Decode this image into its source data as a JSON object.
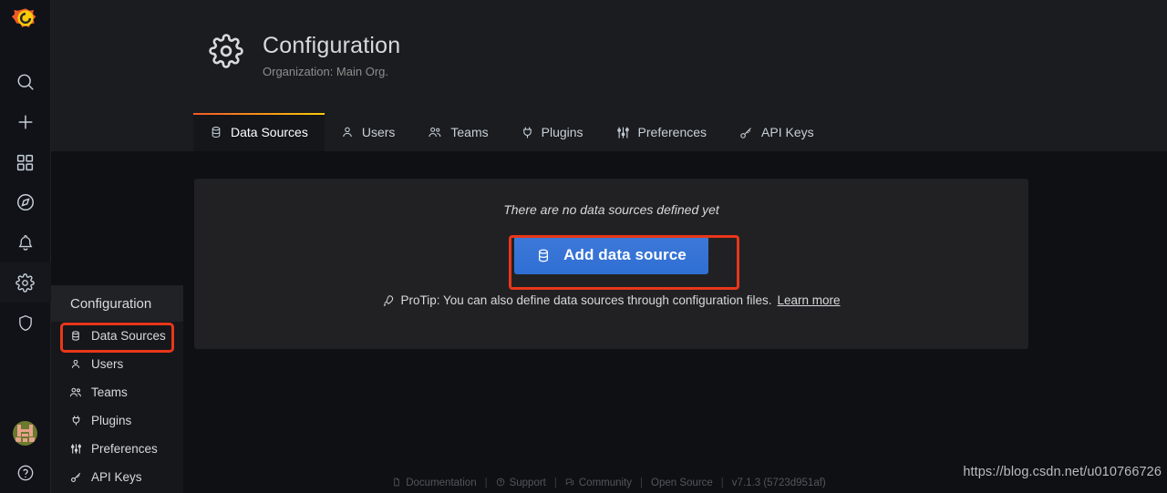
{
  "app": {
    "logo_icon": "grafana-logo-icon",
    "background_color": "#0e1014",
    "panel_color": "#212124",
    "accent_color": "#3274d9",
    "highlight_color": "#e8371a",
    "tab_gradient_from": "#f05a28",
    "tab_gradient_to": "#fbca0a"
  },
  "sidebar": {
    "items": [
      {
        "name": "search",
        "icon": "search-icon",
        "label": "Search"
      },
      {
        "name": "create",
        "icon": "plus-icon",
        "label": "Create"
      },
      {
        "name": "dashboards",
        "icon": "apps-grid-icon",
        "label": "Dashboards"
      },
      {
        "name": "explore",
        "icon": "compass-icon",
        "label": "Explore"
      },
      {
        "name": "alerting",
        "icon": "bell-icon",
        "label": "Alerting"
      },
      {
        "name": "configuration",
        "icon": "gear-icon",
        "label": "Configuration",
        "active": true
      },
      {
        "name": "server-admin",
        "icon": "shield-icon",
        "label": "Server Admin"
      }
    ],
    "bottom": [
      {
        "name": "user-avatar",
        "icon": "avatar-icon",
        "label": "User"
      },
      {
        "name": "help",
        "icon": "question-circle-icon",
        "label": "Help"
      }
    ]
  },
  "header": {
    "icon": "gear-icon",
    "title": "Configuration",
    "subtitle": "Organization: Main Org."
  },
  "tabs": [
    {
      "label": "Data Sources",
      "icon": "database-icon",
      "active": true
    },
    {
      "label": "Users",
      "icon": "user-icon",
      "active": false
    },
    {
      "label": "Teams",
      "icon": "users-alt-icon",
      "active": false
    },
    {
      "label": "Plugins",
      "icon": "plug-icon",
      "active": false
    },
    {
      "label": "Preferences",
      "icon": "sliders-icon",
      "active": false
    },
    {
      "label": "API Keys",
      "icon": "key-icon",
      "active": false
    }
  ],
  "panel": {
    "empty_message": "There are no data sources defined yet",
    "add_button": {
      "label": "Add data source",
      "icon": "database-icon"
    },
    "protip": {
      "icon": "rocket-icon",
      "text": "ProTip: You can also define data sources through configuration files.",
      "link_label": "Learn more"
    }
  },
  "flyout": {
    "title": "Configuration",
    "items": [
      {
        "label": "Data Sources",
        "icon": "database-icon",
        "highlighted": true
      },
      {
        "label": "Users",
        "icon": "user-icon"
      },
      {
        "label": "Teams",
        "icon": "users-alt-icon"
      },
      {
        "label": "Plugins",
        "icon": "plug-icon"
      },
      {
        "label": "Preferences",
        "icon": "sliders-icon"
      },
      {
        "label": "API Keys",
        "icon": "key-icon"
      }
    ]
  },
  "footer": {
    "links": [
      {
        "label": "Documentation",
        "icon": "file-icon"
      },
      {
        "label": "Support",
        "icon": "question-circle-icon"
      },
      {
        "label": "Community",
        "icon": "comments-icon"
      },
      {
        "label": "Open Source",
        "icon": ""
      }
    ],
    "separator": "|",
    "version": "v7.1.3 (5723d951af)"
  },
  "watermark": {
    "text": "https://blog.csdn.net/u010766726"
  }
}
